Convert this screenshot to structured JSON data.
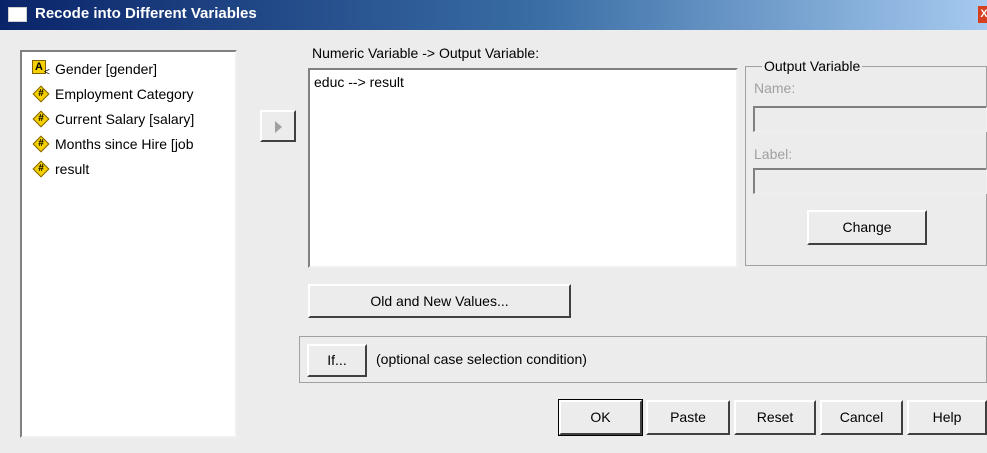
{
  "window": {
    "title": "Recode into Different Variables",
    "close_glyph": "X"
  },
  "variables": [
    {
      "icon": "string",
      "label": "Gender [gender]"
    },
    {
      "icon": "numeric",
      "label": "Employment Category"
    },
    {
      "icon": "numeric",
      "label": "Current Salary [salary]"
    },
    {
      "icon": "numeric",
      "label": "Months since Hire [job"
    },
    {
      "icon": "numeric",
      "label": "result"
    }
  ],
  "icons": {
    "string_symbol": "A",
    "numeric_symbol": "#"
  },
  "mapping": {
    "label": "Numeric Variable -> Output Variable:",
    "items": [
      "educ --> result"
    ]
  },
  "output_variable": {
    "legend": "Output Variable",
    "name_label": "Name:",
    "name_value": "",
    "label_label": "Label:",
    "label_value": "",
    "change_button": "Change"
  },
  "old_new_button": "Old and New Values...",
  "if_section": {
    "button": "If...",
    "text": "(optional case selection condition)"
  },
  "buttons": {
    "ok": "OK",
    "paste": "Paste",
    "reset": "Reset",
    "cancel": "Cancel",
    "help": "Help"
  }
}
